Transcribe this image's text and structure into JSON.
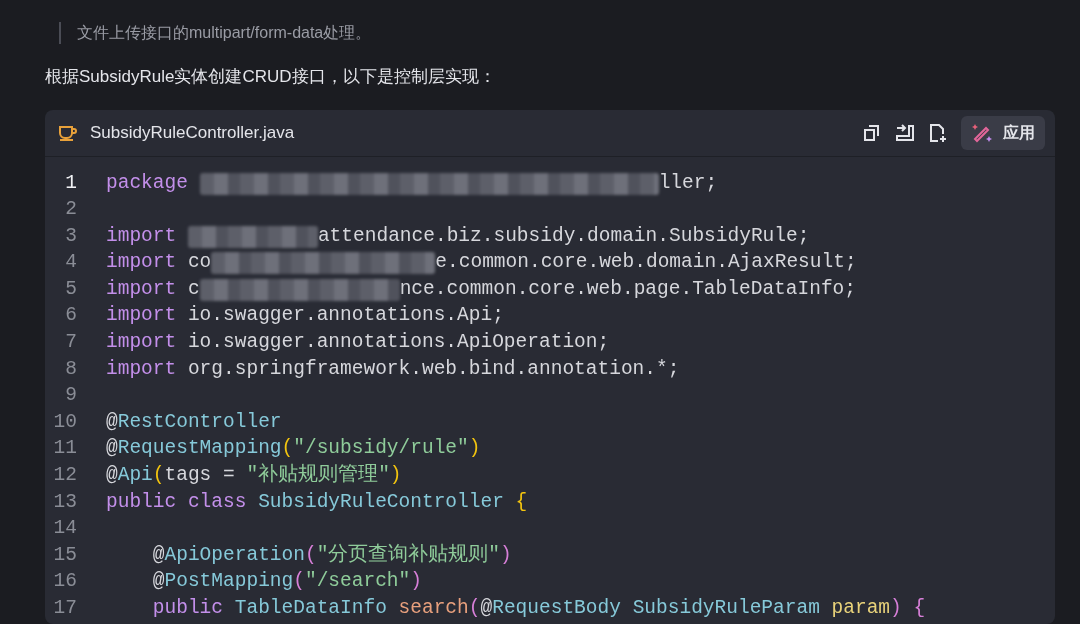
{
  "quote": "文件上传接口的multipart/form-data处理。",
  "paragraph": "根据SubsidyRule实体创建CRUD接口，以下是控制层实现：",
  "code_block": {
    "filename": "SubsidyRuleController.java",
    "apply_button": "应用",
    "lines": [
      {
        "number": "1",
        "current": true,
        "tokens": [
          {
            "kind": "kw",
            "text": "package "
          },
          {
            "kind": "redacted"
          },
          {
            "kind": "plain",
            "text": "ller;"
          }
        ]
      },
      {
        "number": "2",
        "current": false
      },
      {
        "number": "3",
        "current": false,
        "tokens": [
          {
            "kind": "kw",
            "text": "import "
          },
          {
            "kind": "redacted"
          },
          {
            "kind": "plain",
            "text": "attendance.biz.subsidy.domain.SubsidyRule;"
          }
        ]
      },
      {
        "number": "4",
        "current": false,
        "tokens": [
          {
            "kind": "kw",
            "text": "import"
          },
          {
            "kind": "plain",
            "text": " co"
          },
          {
            "kind": "redacted"
          },
          {
            "kind": "plain",
            "text": "e.common.core.web.domain.AjaxResult;"
          }
        ]
      },
      {
        "number": "5",
        "current": false,
        "tokens": [
          {
            "kind": "kw",
            "text": "import"
          },
          {
            "kind": "plain",
            "text": " c"
          },
          {
            "kind": "redacted"
          },
          {
            "kind": "plain",
            "text": "nce.common.core.web.page.TableDataInfo;"
          }
        ]
      },
      {
        "number": "6",
        "current": false,
        "tokens": [
          {
            "kind": "kw",
            "text": "import"
          },
          {
            "kind": "plain",
            "text": " io.swagger.annotations.Api;"
          }
        ]
      },
      {
        "number": "7",
        "current": false,
        "tokens": [
          {
            "kind": "kw",
            "text": "import"
          },
          {
            "kind": "plain",
            "text": " io.swagger.annotations.ApiOperation;"
          }
        ]
      },
      {
        "number": "8",
        "current": false,
        "tokens": [
          {
            "kind": "kw",
            "text": "import"
          },
          {
            "kind": "plain",
            "text": " org.springframework.web.bind.annotation.*;"
          }
        ]
      },
      {
        "number": "9",
        "current": false
      },
      {
        "number": "10",
        "current": false,
        "tokens": [
          {
            "kind": "at",
            "text": "@"
          },
          {
            "kind": "ann",
            "text": "RestController"
          }
        ]
      },
      {
        "number": "11",
        "current": false,
        "tokens": [
          {
            "kind": "at",
            "text": "@"
          },
          {
            "kind": "ann",
            "text": "RequestMapping"
          },
          {
            "kind": "bracket1",
            "text": "("
          },
          {
            "kind": "str",
            "text": "\"/subsidy/rule\""
          },
          {
            "kind": "bracket1",
            "text": ")"
          }
        ]
      },
      {
        "number": "12",
        "current": false,
        "tokens": [
          {
            "kind": "at",
            "text": "@"
          },
          {
            "kind": "ann",
            "text": "Api"
          },
          {
            "kind": "bracket1",
            "text": "("
          },
          {
            "kind": "plain",
            "text": "tags = "
          },
          {
            "kind": "str",
            "text": "\"补贴规则管理\""
          },
          {
            "kind": "bracket1",
            "text": ")"
          }
        ]
      },
      {
        "number": "13",
        "current": false,
        "tokens": [
          {
            "kind": "kw",
            "text": "public class "
          },
          {
            "kind": "type",
            "text": "SubsidyRuleController "
          },
          {
            "kind": "bracket1",
            "text": "{"
          }
        ]
      },
      {
        "number": "14",
        "current": false
      },
      {
        "number": "15",
        "current": false,
        "tokens": [
          {
            "kind": "at",
            "text": "    @"
          },
          {
            "kind": "ann",
            "text": "ApiOperation"
          },
          {
            "kind": "bracket2",
            "text": "("
          },
          {
            "kind": "str",
            "text": "\"分页查询补贴规则\""
          },
          {
            "kind": "bracket2",
            "text": ")"
          }
        ]
      },
      {
        "number": "16",
        "current": false,
        "tokens": [
          {
            "kind": "at",
            "text": "    @"
          },
          {
            "kind": "ann",
            "text": "PostMapping"
          },
          {
            "kind": "bracket2",
            "text": "("
          },
          {
            "kind": "str",
            "text": "\"/search\""
          },
          {
            "kind": "bracket2",
            "text": ")"
          }
        ]
      },
      {
        "number": "17",
        "current": false,
        "tokens": [
          {
            "kind": "kw",
            "text": "    public "
          },
          {
            "kind": "type",
            "text": "TableDataInfo "
          },
          {
            "kind": "fn",
            "text": "search"
          },
          {
            "kind": "bracket2",
            "text": "("
          },
          {
            "kind": "at",
            "text": "@"
          },
          {
            "kind": "ann",
            "text": "RequestBody "
          },
          {
            "kind": "type",
            "text": "SubsidyRuleParam "
          },
          {
            "kind": "param",
            "text": "param"
          },
          {
            "kind": "bracket2",
            "text": ") {"
          }
        ]
      }
    ]
  }
}
